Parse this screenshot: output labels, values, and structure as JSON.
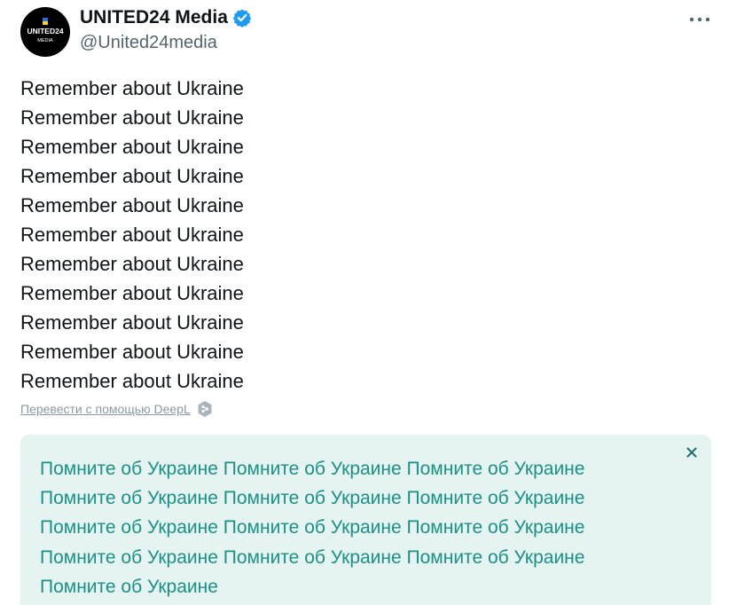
{
  "author": {
    "display_name": "UNITED24 Media",
    "handle": "@United24media",
    "avatar_text_top": "UNITED24",
    "avatar_text_bottom": "MEDIA",
    "verified": true
  },
  "tweet": {
    "lines": [
      "Remember about Ukraine",
      "Remember about Ukraine",
      "Remember about Ukraine",
      "Remember about Ukraine",
      "Remember about Ukraine",
      "Remember about Ukraine",
      "Remember about Ukraine",
      "Remember about Ukraine",
      "Remember about Ukraine",
      "Remember about Ukraine",
      "Remember about Ukraine"
    ]
  },
  "translate": {
    "link_label": "Перевести с помощью DeepL",
    "icon": "deepl-icon"
  },
  "translation": {
    "text": "Помните об Украине Помните об Украине Помните об Украине Помните об Украине Помните об Украине Помните об Украине Помните об Украине Помните об Украине Помните об Украине Помните об Украине Помните об Украине Помните об Украине Помните об Украине",
    "close_icon": "close-icon"
  },
  "colors": {
    "verified": "#1d9bf0",
    "translation_bg": "#e6f4f1",
    "translation_text": "#1a9187",
    "flag_blue": "#2a6fdb",
    "flag_yellow": "#f6d32d"
  }
}
